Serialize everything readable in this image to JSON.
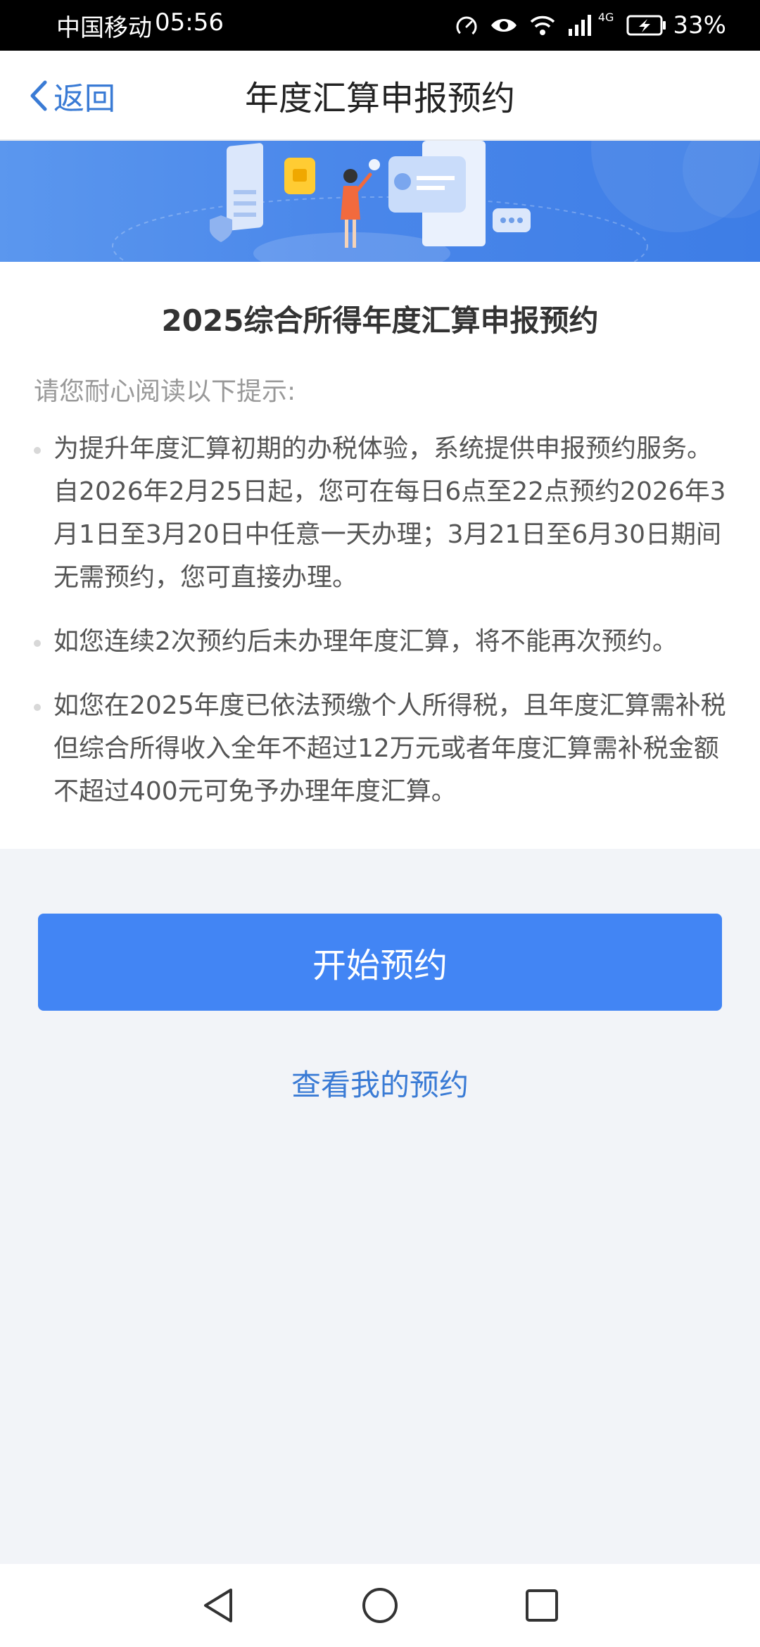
{
  "status_bar": {
    "carrier": "中国移动",
    "time": "05:56",
    "network": "4G",
    "battery": "33%",
    "icons": [
      "speed-icon",
      "eye-icon",
      "wifi-icon",
      "signal-icon",
      "battery-icon"
    ]
  },
  "nav": {
    "back_label": "返回",
    "title": "年度汇算申报预约"
  },
  "content": {
    "title": "2025综合所得年度汇算申报预约",
    "intro": "请您耐心阅读以下提示:",
    "tips": [
      "为提升年度汇算初期的办税体验，系统提供申报预约服务。自2026年2月25日起，您可在每日6点至22点预约2026年3月1日至3月20日中任意一天办理；3月21日至6月30日期间无需预约，您可直接办理。",
      "如您连续2次预约后未办理年度汇算，将不能再次预约。",
      "如您在2025年度已依法预缴个人所得税，且年度汇算需补税但综合所得收入全年不超过12万元或者年度汇算需补税金额不超过400元可免予办理年度汇算。"
    ]
  },
  "actions": {
    "primary_label": "开始预约",
    "secondary_label": "查看我的预约"
  },
  "system_nav": {
    "icons": [
      "back-triangle-icon",
      "home-circle-icon",
      "recents-square-icon"
    ]
  },
  "colors": {
    "accent": "#4285f4",
    "link": "#3a7bd5",
    "banner": "#4a87ea",
    "background": "#f2f4f8"
  }
}
